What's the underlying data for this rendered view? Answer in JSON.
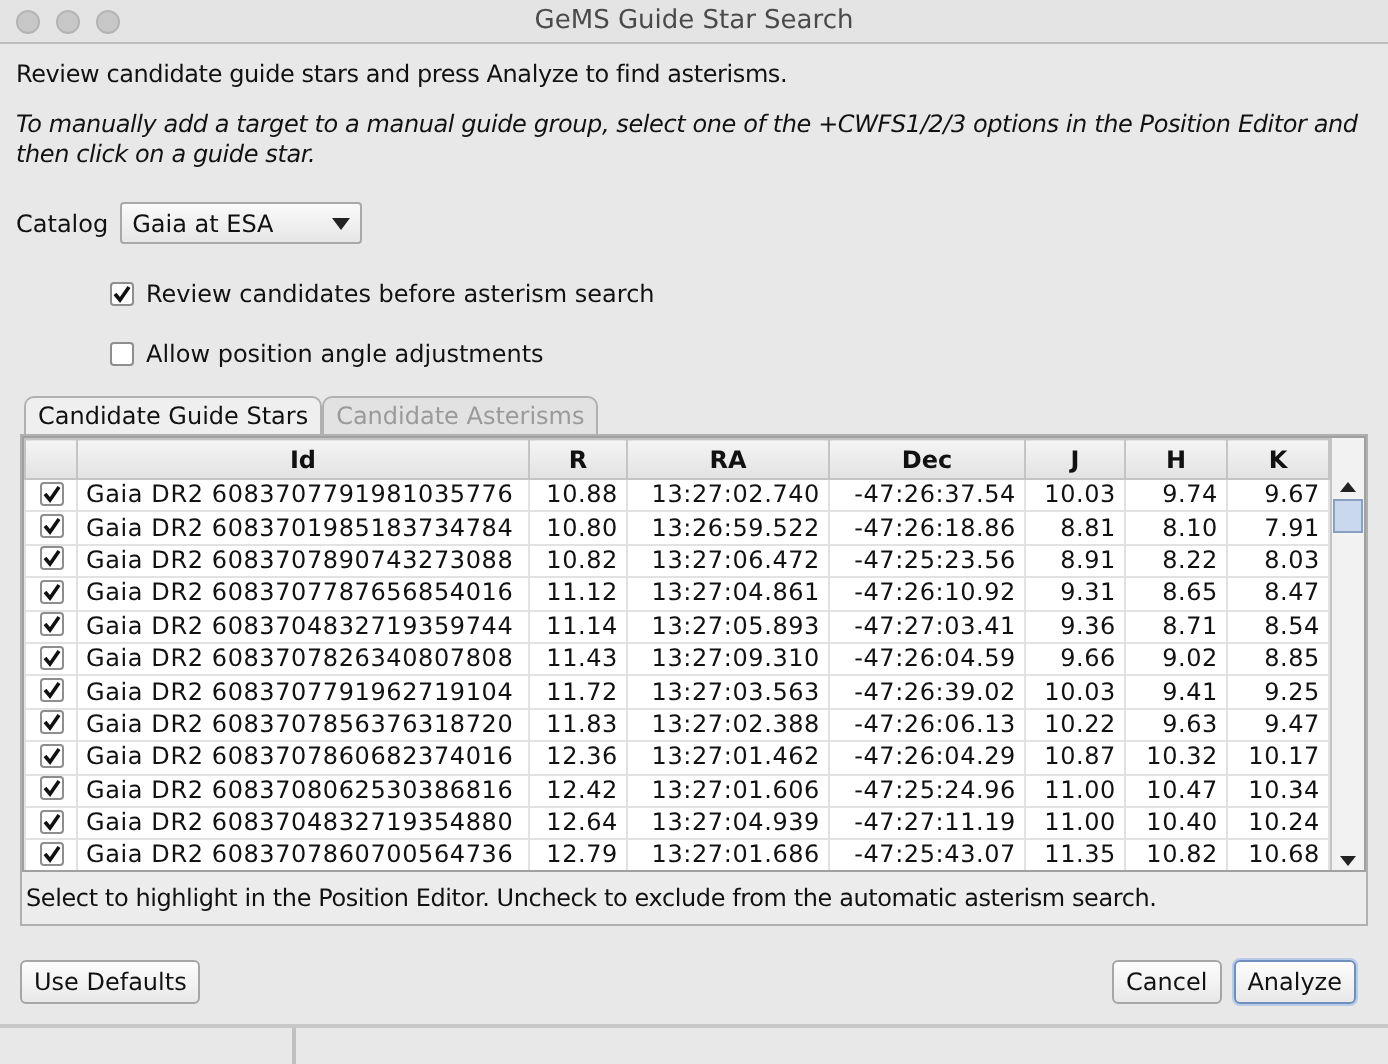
{
  "window": {
    "title": "GeMS Guide Star Search"
  },
  "intro": "Review candidate guide stars and press Analyze to find asterisms.",
  "note": "To manually add a target to a manual guide group, select one of the +CWFS1/2/3 options in the Position Editor and then click on a guide star.",
  "catalog": {
    "label": "Catalog",
    "value": "Gaia at ESA"
  },
  "options": [
    {
      "label": "Review candidates before asterism search",
      "checked": true
    },
    {
      "label": "Allow position angle adjustments",
      "checked": false
    }
  ],
  "tabs": [
    {
      "label": "Candidate Guide Stars",
      "selected": true,
      "disabled": false
    },
    {
      "label": "Candidate Asterisms",
      "selected": false,
      "disabled": true
    }
  ],
  "table": {
    "columns": [
      "Id",
      "R",
      "RA",
      "Dec",
      "J",
      "H",
      "K"
    ],
    "rows": [
      {
        "checked": true,
        "cells": [
          "Gaia DR2 6083707791981035776",
          "10.88",
          "13:27:02.740",
          "-47:26:37.54",
          "10.03",
          "9.74",
          "9.67"
        ]
      },
      {
        "checked": true,
        "cells": [
          "Gaia DR2 6083701985183734784",
          "10.80",
          "13:26:59.522",
          "-47:26:18.86",
          "8.81",
          "8.10",
          "7.91"
        ]
      },
      {
        "checked": true,
        "cells": [
          "Gaia DR2 6083707890743273088",
          "10.82",
          "13:27:06.472",
          "-47:25:23.56",
          "8.91",
          "8.22",
          "8.03"
        ]
      },
      {
        "checked": true,
        "cells": [
          "Gaia DR2 6083707787656854016",
          "11.12",
          "13:27:04.861",
          "-47:26:10.92",
          "9.31",
          "8.65",
          "8.47"
        ]
      },
      {
        "checked": true,
        "cells": [
          "Gaia DR2 6083704832719359744",
          "11.14",
          "13:27:05.893",
          "-47:27:03.41",
          "9.36",
          "8.71",
          "8.54"
        ]
      },
      {
        "checked": true,
        "cells": [
          "Gaia DR2 6083707826340807808",
          "11.43",
          "13:27:09.310",
          "-47:26:04.59",
          "9.66",
          "9.02",
          "8.85"
        ]
      },
      {
        "checked": true,
        "cells": [
          "Gaia DR2 6083707791962719104",
          "11.72",
          "13:27:03.563",
          "-47:26:39.02",
          "10.03",
          "9.41",
          "9.25"
        ]
      },
      {
        "checked": true,
        "cells": [
          "Gaia DR2 6083707856376318720",
          "11.83",
          "13:27:02.388",
          "-47:26:06.13",
          "10.22",
          "9.63",
          "9.47"
        ]
      },
      {
        "checked": true,
        "cells": [
          "Gaia DR2 6083707860682374016",
          "12.36",
          "13:27:01.462",
          "-47:26:04.29",
          "10.87",
          "10.32",
          "10.17"
        ]
      },
      {
        "checked": true,
        "cells": [
          "Gaia DR2 6083708062530386816",
          "12.42",
          "13:27:01.606",
          "-47:25:24.96",
          "11.00",
          "10.47",
          "10.34"
        ]
      },
      {
        "checked": true,
        "cells": [
          "Gaia DR2 6083704832719354880",
          "12.64",
          "13:27:04.939",
          "-47:27:11.19",
          "11.00",
          "10.40",
          "10.24"
        ]
      },
      {
        "checked": true,
        "cells": [
          "Gaia DR2 6083707860700564736",
          "12.79",
          "13:27:01.686",
          "-47:25:43.07",
          "11.35",
          "10.82",
          "10.68"
        ]
      }
    ]
  },
  "hint": "Select to highlight in the Position Editor. Uncheck to exclude from the automatic asterism search.",
  "buttons": [
    {
      "label": "Use Defaults",
      "kind": "left",
      "default": false
    },
    {
      "label": "Cancel",
      "kind": "right",
      "default": false
    },
    {
      "label": "Analyze",
      "kind": "right",
      "default": true
    }
  ]
}
